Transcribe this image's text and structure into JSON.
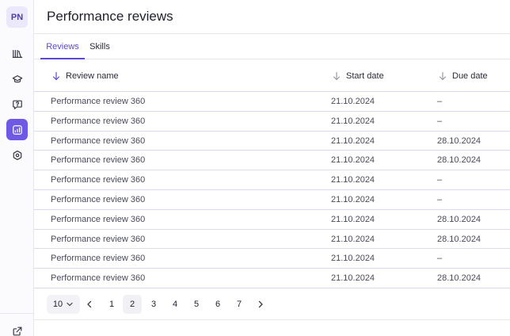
{
  "user": {
    "initials": "PN"
  },
  "header": {
    "title": "Performance reviews"
  },
  "tabs": [
    {
      "label": "Reviews",
      "active": true
    },
    {
      "label": "Skills",
      "active": false
    }
  ],
  "table": {
    "columns": [
      "Review name",
      "Start date",
      "Due date"
    ],
    "rows": [
      [
        "Performance review 360",
        "21.10.2024",
        "–"
      ],
      [
        "Performance review 360",
        "21.10.2024",
        "–"
      ],
      [
        "Performance review 360",
        "21.10.2024",
        "28.10.2024"
      ],
      [
        "Performance review 360",
        "21.10.2024",
        "28.10.2024"
      ],
      [
        "Performance review 360",
        "21.10.2024",
        "–"
      ],
      [
        "Performance review 360",
        "21.10.2024",
        "–"
      ],
      [
        "Performance review 360",
        "21.10.2024",
        "28.10.2024"
      ],
      [
        "Performance review 360",
        "21.10.2024",
        "28.10.2024"
      ],
      [
        "Performance review 360",
        "21.10.2024",
        "–"
      ],
      [
        "Performance review 360",
        "21.10.2024",
        "28.10.2024"
      ]
    ]
  },
  "pagination": {
    "page_size": "10",
    "pages": [
      "1",
      "2",
      "3",
      "4",
      "5",
      "6",
      "7"
    ],
    "current_page": "2"
  },
  "colors": {
    "accent": "#6e59e6",
    "tab_active": "#5b47d6",
    "row_border": "#dcd8f3"
  },
  "icons": [
    "library-icon",
    "graduation-cap-icon",
    "help-bubble-icon",
    "analytics-icon",
    "settings-hexagon-icon",
    "external-link-icon",
    "sort-arrow-down-icon",
    "chevron-down-icon",
    "chevron-left-icon",
    "chevron-right-icon"
  ]
}
